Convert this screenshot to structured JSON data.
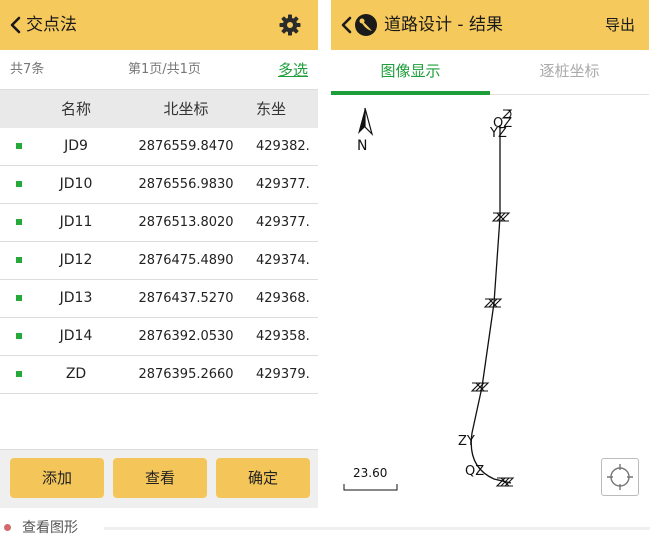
{
  "left": {
    "title": "交点法",
    "icons": {
      "back": "chevron-left-icon",
      "settings": "gear-icon"
    },
    "pager": {
      "total": "共7条",
      "page": "第1页/共1页",
      "multi_select": "多选"
    },
    "columns": {
      "name": "名称",
      "north": "北坐标",
      "east": "东坐"
    },
    "rows": [
      {
        "name": "JD9",
        "north": "2876559.8470",
        "east": "429382."
      },
      {
        "name": "JD10",
        "north": "2876556.9830",
        "east": "429377."
      },
      {
        "name": "JD11",
        "north": "2876513.8020",
        "east": "429377."
      },
      {
        "name": "JD12",
        "north": "2876475.4890",
        "east": "429374."
      },
      {
        "name": "JD13",
        "north": "2876437.5270",
        "east": "429368."
      },
      {
        "name": "JD14",
        "north": "2876392.0530",
        "east": "429358."
      },
      {
        "name": "ZD",
        "north": "2876395.2660",
        "east": "429379."
      }
    ],
    "buttons": {
      "add": "添加",
      "view": "查看",
      "confirm": "确定"
    },
    "colors": {
      "accent": "#f5c95c",
      "green": "#1e9e3a"
    }
  },
  "right": {
    "title": "道路设计 - 结果",
    "export": "导出",
    "icons": {
      "back": "chevron-left-icon",
      "logo": "app-logo-icon",
      "locate": "locate-target-icon",
      "north": "north-arrow-icon"
    },
    "tabs": {
      "graphic": "图像显示",
      "stake": "逐桩坐标"
    },
    "map": {
      "north_label": "N",
      "labels": {
        "qz": "QZ",
        "yz": "YZ",
        "zy": "ZY"
      },
      "scale": "23.60"
    }
  },
  "caption": {
    "text": "查看图形"
  }
}
